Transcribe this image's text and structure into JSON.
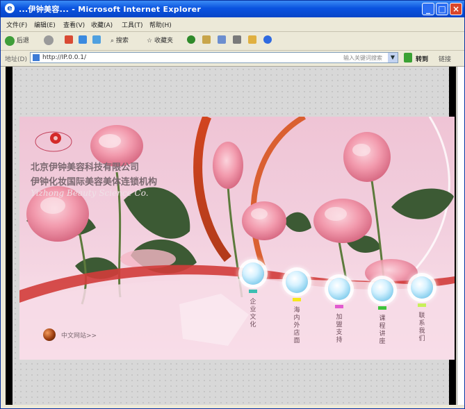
{
  "window": {
    "title": "...伊钟美容... - Microsoft Internet Explorer"
  },
  "menu": [
    "文件(F)",
    "编辑(E)",
    "查看(V)",
    "收藏(A)",
    "工具(T)",
    "帮助(H)"
  ],
  "toolbar": {
    "back": "后退",
    "search": "搜索",
    "favorites": "收藏夹"
  },
  "address": {
    "label": "地址(D)",
    "url": "http://IP.0.0.1/",
    "hint": "输入关键词搜索",
    "go": "转到",
    "links": "链接"
  },
  "site": {
    "company_line1": "北京伊钟美容科技有限公司",
    "company_line2": "伊钟化妆国际美容美体连锁机构",
    "company_line3": "Yizhong Beauty Science Co.",
    "home_link": "中文网站>>",
    "nav": [
      {
        "label": "企业文化",
        "color": "#3bbfb2"
      },
      {
        "label": "海内外店面",
        "color": "#f5e81a"
      },
      {
        "label": "加盟支持",
        "color": "#e25bd0"
      },
      {
        "label": "课程讲座",
        "color": "#3ec23b"
      },
      {
        "label": "联系我们",
        "color": "#c8f05a"
      }
    ]
  },
  "icons": [
    "internet-explorer-icon",
    "minimize-icon",
    "maximize-icon",
    "close-icon",
    "windows-logo-icon",
    "page-icon",
    "go-arrow-icon",
    "rose-logo-icon",
    "home-ball-icon"
  ],
  "colors": {
    "titlebar": "#0a53e0",
    "banner_pink": "#f2cfde",
    "arc_red": "#c8361e"
  }
}
